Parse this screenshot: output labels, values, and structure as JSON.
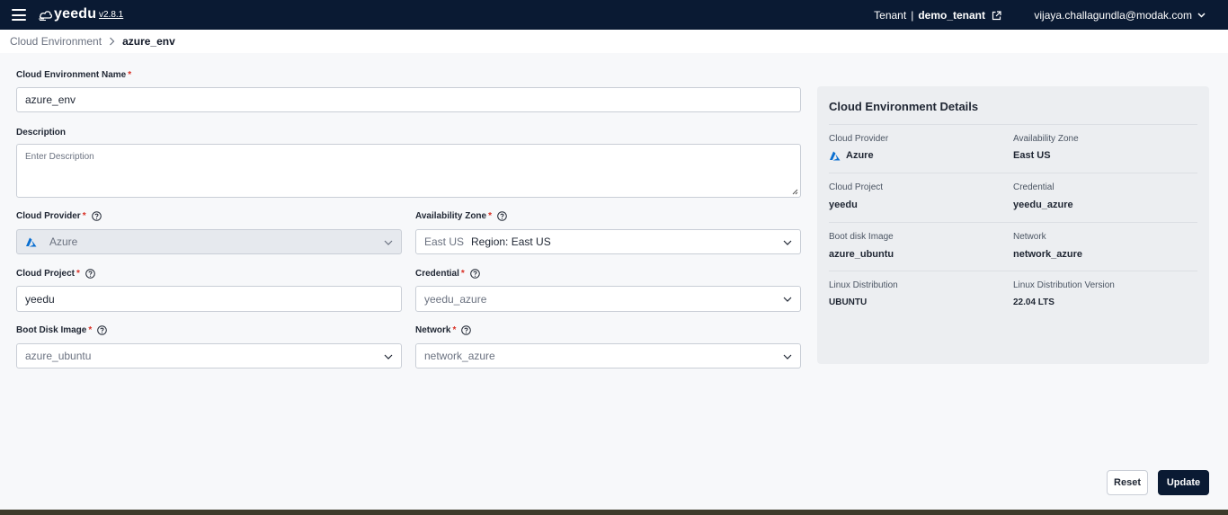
{
  "header": {
    "app_name": "yeedu",
    "version": "v2.8.1",
    "tenant_label": "Tenant",
    "tenant_sep": "|",
    "tenant_name": "demo_tenant",
    "user_email": "vijaya.challagundla@modak.com"
  },
  "breadcrumb": {
    "parent": "Cloud Environment",
    "current": "azure_env"
  },
  "form": {
    "name": {
      "label": "Cloud Environment Name",
      "required": "*",
      "value": "azure_env"
    },
    "description": {
      "label": "Description",
      "placeholder": "Enter Description",
      "value": ""
    },
    "cloud_provider": {
      "label": "Cloud Provider",
      "required": "*",
      "value": "Azure"
    },
    "availability_zone": {
      "label": "Availability Zone",
      "required": "*",
      "value": "East US",
      "region": "Region: East US"
    },
    "cloud_project": {
      "label": "Cloud Project",
      "required": "*",
      "value": "yeedu"
    },
    "credential": {
      "label": "Credential",
      "required": "*",
      "value": "yeedu_azure"
    },
    "boot_disk_image": {
      "label": "Boot Disk Image",
      "required": "*",
      "value": "azure_ubuntu"
    },
    "network": {
      "label": "Network",
      "required": "*",
      "value": "network_azure"
    }
  },
  "details": {
    "title": "Cloud Environment Details",
    "items": [
      {
        "key": "Cloud Provider",
        "value": "Azure"
      },
      {
        "key": "Availability Zone",
        "value": "East US"
      },
      {
        "key": "Cloud Project",
        "value": "yeedu"
      },
      {
        "key": "Credential",
        "value": "yeedu_azure"
      },
      {
        "key": "Boot disk Image",
        "value": "azure_ubuntu"
      },
      {
        "key": "Network",
        "value": "network_azure"
      },
      {
        "key": "Linux Distribution",
        "value": "UBUNTU"
      },
      {
        "key": "Linux Distribution Version",
        "value": "22.04 LTS"
      }
    ]
  },
  "actions": {
    "reset_label": "Reset",
    "update_label": "Update"
  },
  "colors": {
    "header_bg": "#0a1a33",
    "azure_blue": "#0a6fd1",
    "required": "#d93025"
  },
  "icons": [
    "hamburger-menu-icon",
    "yeedu-logo-icon",
    "external-link-icon",
    "chevron-down-icon",
    "help-circle-icon",
    "azure-logo-icon",
    "chevron-right-icon"
  ]
}
